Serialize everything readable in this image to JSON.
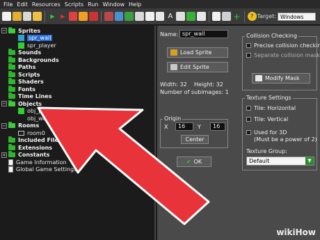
{
  "menubar": {
    "items": [
      "File",
      "Edit",
      "Resources",
      "Scripts",
      "Run",
      "Window",
      "Help"
    ]
  },
  "toolbar": {
    "target_label": "Target:",
    "target_value": "Windows"
  },
  "tree": {
    "sprites": "Sprites",
    "sprite_children": [
      "spr_wall",
      "spr_player"
    ],
    "sounds": "Sounds",
    "backgrounds": "Backgrounds",
    "paths": "Paths",
    "scripts": "Scripts",
    "shaders": "Shaders",
    "fonts": "Fonts",
    "time_lines": "Time Lines",
    "objects": "Objects",
    "object_children": [
      "obj_player",
      "obj_wall"
    ],
    "rooms": "Rooms",
    "room_children": [
      "room0"
    ],
    "included_files": "Included Files",
    "extensions": "Extensions",
    "constants": "Constants",
    "game_information": "Game Information",
    "global_game_settings": "Global Game Settings"
  },
  "sprite_panel": {
    "name_label": "Name:",
    "name_value": "spr_wall",
    "load_sprite": "Load Sprite",
    "edit_sprite": "Edit Sprite",
    "width_text": "Width: 32",
    "height_text": "Height: 32",
    "subimages_text": "Number of subimages: 1",
    "origin": {
      "title": "Origin",
      "x_label": "X",
      "x_value": "16",
      "y_label": "Y",
      "y_value": "16",
      "center_button": "Center"
    },
    "ok_button": "OK",
    "collision": {
      "title": "Collision Checking",
      "precise": "Precise collision checking",
      "separate": "Separate collision masks",
      "modify_mask": "Modify Mask"
    },
    "texture": {
      "title": "Texture Settings",
      "tile_h": "Tile: Horizontal",
      "tile_v": "Tile: Vertical",
      "used_3d": "Used for 3D",
      "used_3d_note": "(Must be a power of 2)",
      "group_label": "Texture Group:",
      "group_value": "Default"
    }
  },
  "watermark": {
    "brand": "wikiHow"
  },
  "colors": {
    "folder_green": "#2fb52f",
    "selection_blue": "#2b6cd6",
    "pointer_red": "#e8333a"
  }
}
